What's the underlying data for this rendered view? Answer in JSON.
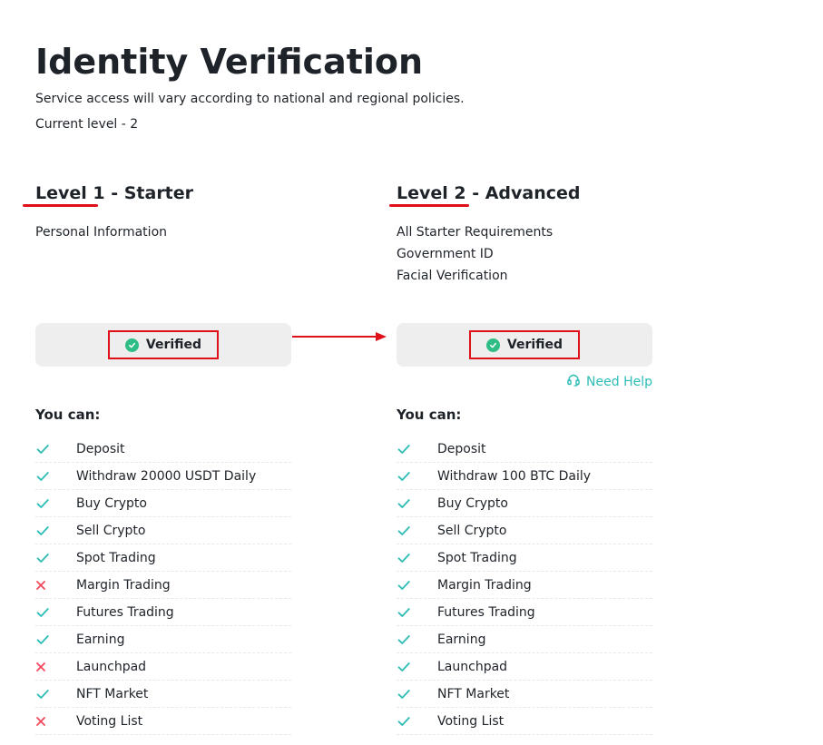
{
  "header": {
    "title": "Identity Verification",
    "subtitle": "Service access will vary according to national and regional policies.",
    "current_level": "Current level - 2"
  },
  "colors": {
    "check": "#2dbdb6",
    "cross": "#f6465d",
    "verified": "#2ebd85",
    "annotation": "#e0101b"
  },
  "levels": [
    {
      "title": "Level 1 - Starter",
      "requirements": [
        "Personal Information"
      ],
      "status": "Verified",
      "you_can": "You can:",
      "permissions": [
        {
          "label": "Deposit",
          "allowed": true
        },
        {
          "label": "Withdraw 20000 USDT Daily",
          "allowed": true
        },
        {
          "label": "Buy Crypto",
          "allowed": true
        },
        {
          "label": "Sell Crypto",
          "allowed": true
        },
        {
          "label": "Spot Trading",
          "allowed": true
        },
        {
          "label": "Margin Trading",
          "allowed": false
        },
        {
          "label": "Futures Trading",
          "allowed": true
        },
        {
          "label": "Earning",
          "allowed": true
        },
        {
          "label": "Launchpad",
          "allowed": false
        },
        {
          "label": "NFT Market",
          "allowed": true
        },
        {
          "label": "Voting List",
          "allowed": false
        }
      ]
    },
    {
      "title": "Level 2 - Advanced",
      "requirements": [
        "All Starter Requirements",
        "Government ID",
        "Facial Verification"
      ],
      "status": "Verified",
      "need_help": "Need Help",
      "you_can": "You can:",
      "permissions": [
        {
          "label": "Deposit",
          "allowed": true
        },
        {
          "label": "Withdraw 100 BTC Daily",
          "allowed": true
        },
        {
          "label": "Buy Crypto",
          "allowed": true
        },
        {
          "label": "Sell Crypto",
          "allowed": true
        },
        {
          "label": "Spot Trading",
          "allowed": true
        },
        {
          "label": "Margin Trading",
          "allowed": true
        },
        {
          "label": "Futures Trading",
          "allowed": true
        },
        {
          "label": "Earning",
          "allowed": true
        },
        {
          "label": "Launchpad",
          "allowed": true
        },
        {
          "label": "NFT Market",
          "allowed": true
        },
        {
          "label": "Voting List",
          "allowed": true
        }
      ]
    }
  ]
}
